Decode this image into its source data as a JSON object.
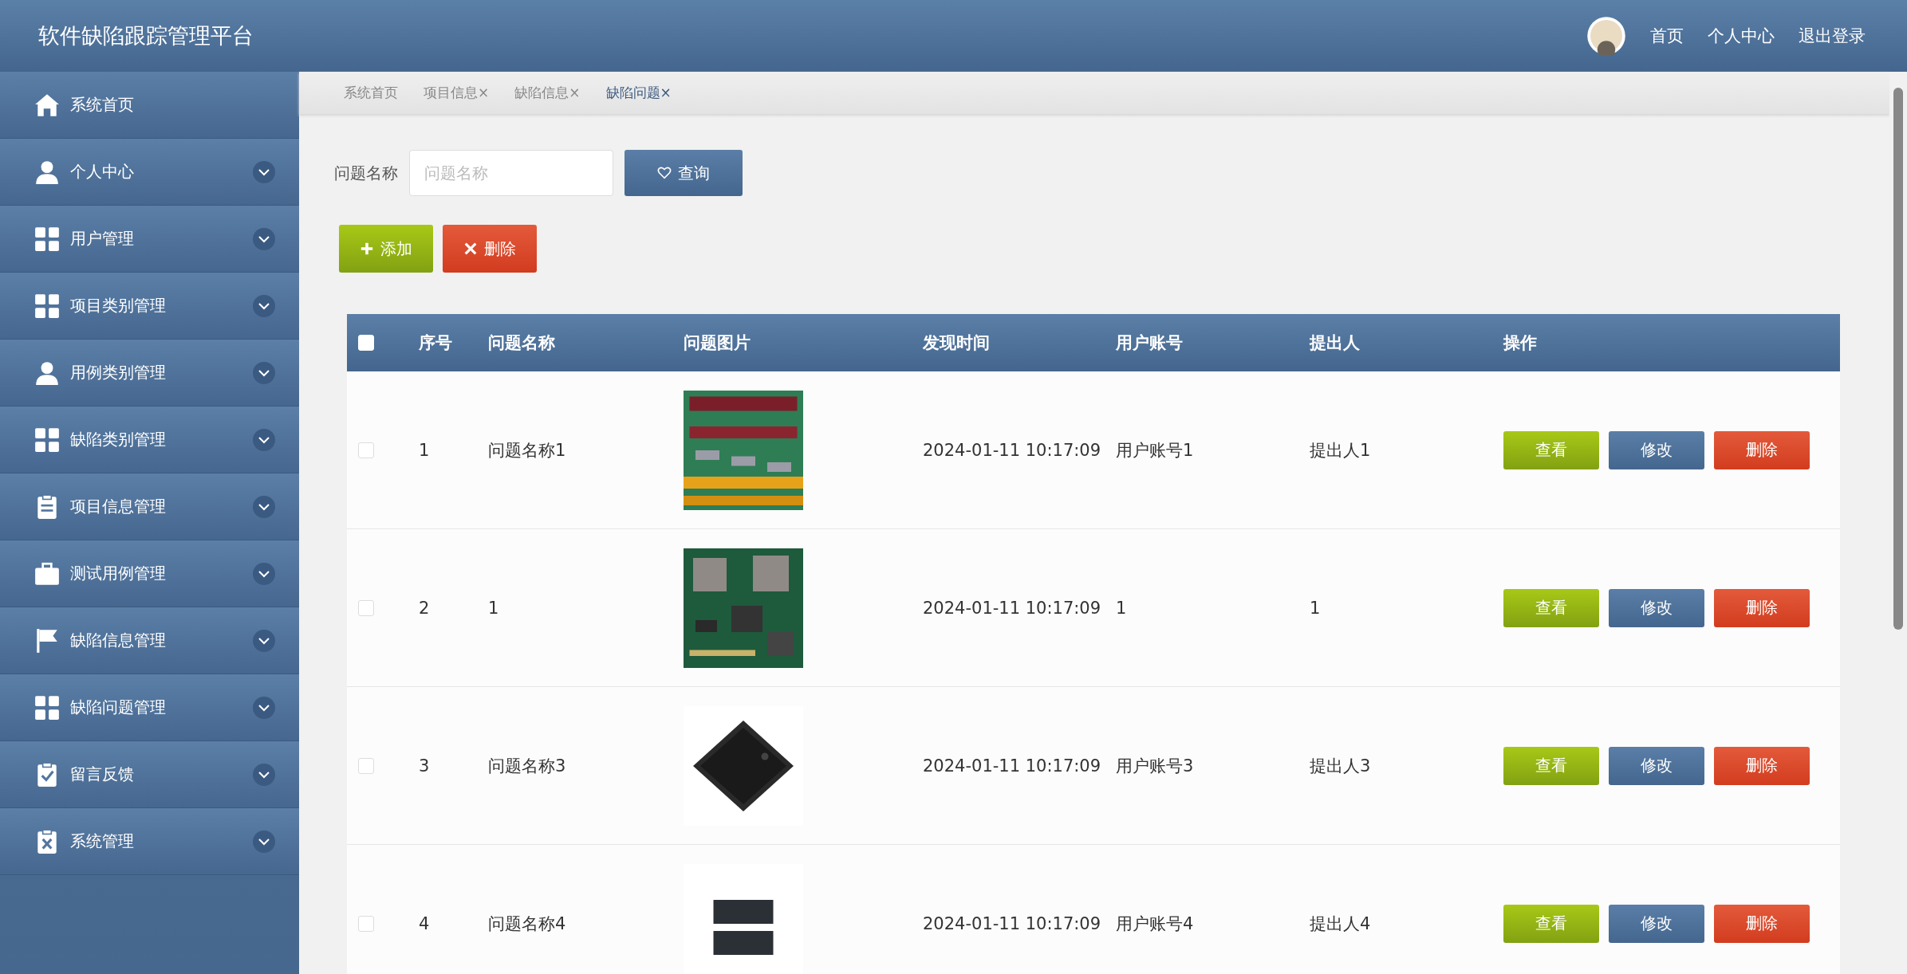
{
  "header": {
    "title": "软件缺陷跟踪管理平台",
    "links": [
      "首页",
      "个人中心",
      "退出登录"
    ]
  },
  "sidebar": {
    "items": [
      {
        "label": "系统首页",
        "expandable": false
      },
      {
        "label": "个人中心",
        "expandable": true
      },
      {
        "label": "用户管理",
        "expandable": true
      },
      {
        "label": "项目类别管理",
        "expandable": true
      },
      {
        "label": "用例类别管理",
        "expandable": true
      },
      {
        "label": "缺陷类别管理",
        "expandable": true
      },
      {
        "label": "项目信息管理",
        "expandable": true
      },
      {
        "label": "测试用例管理",
        "expandable": true
      },
      {
        "label": "缺陷信息管理",
        "expandable": true
      },
      {
        "label": "缺陷问题管理",
        "expandable": true
      },
      {
        "label": "留言反馈",
        "expandable": true
      },
      {
        "label": "系统管理",
        "expandable": true
      }
    ]
  },
  "tabs": [
    {
      "label": "系统首页",
      "selected": false
    },
    {
      "label": "项目信息",
      "close": "×",
      "selected": false
    },
    {
      "label": "缺陷信息",
      "close": "×",
      "selected": false
    },
    {
      "label": "缺陷问题",
      "close": "×",
      "selected": true
    }
  ],
  "search": {
    "label": "问题名称",
    "placeholder": "问题名称",
    "button": "查询"
  },
  "actions": [
    "添加",
    "删除"
  ],
  "table": {
    "select_all": false,
    "columns": [
      "序号",
      "问题名称",
      "问题图片",
      "发现时间",
      "用户账号",
      "提出人",
      "操作"
    ],
    "rows": [
      {
        "checked": false,
        "no": "1",
        "name": "问题名称1",
        "image": {
          "kind": "picture"
        },
        "time": "2024-01-11 10:17:09",
        "account": "用户账号1",
        "reporter": "提出人1",
        "buttons": [
          "查看",
          "修改",
          "删除"
        ]
      },
      {
        "checked": false,
        "no": "2",
        "name": "1",
        "image": {
          "kind": "picture"
        },
        "time": "2024-01-11 10:17:09",
        "account": "1",
        "reporter": "1",
        "buttons": [
          "查看",
          "修改",
          "删除"
        ]
      },
      {
        "checked": false,
        "no": "3",
        "name": "问题名称3",
        "image": {
          "kind": "picture"
        },
        "time": "2024-01-11 10:17:09",
        "account": "用户账号3",
        "reporter": "提出人3",
        "buttons": [
          "查看",
          "修改",
          "删除"
        ]
      },
      {
        "checked": false,
        "no": "4",
        "name": "问题名称4",
        "image": {
          "kind": "picture"
        },
        "time": "2024-01-11 10:17:09",
        "account": "用户账号4",
        "reporter": "提出人4",
        "buttons": [
          "查看",
          "修改",
          "删除"
        ]
      }
    ]
  }
}
